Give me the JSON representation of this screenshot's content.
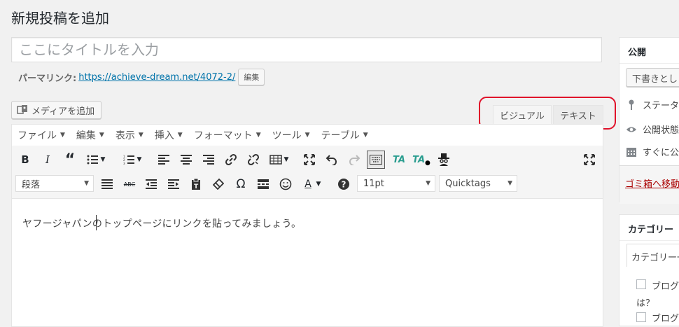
{
  "page_title": "新規投稿を追加",
  "title_placeholder": "ここにタイトルを入力",
  "permalink": {
    "label": "パーマリンク:",
    "url": "https://achieve-dream.net/4072-2/",
    "edit_label": "編集"
  },
  "media_button": "メディアを追加",
  "editor_tabs": {
    "visual": "ビジュアル",
    "text": "テキスト"
  },
  "menubar": [
    "ファイル",
    "編集",
    "表示",
    "挿入",
    "フォーマット",
    "ツール",
    "テーブル"
  ],
  "toolbar": {
    "format_select": "段落",
    "font_size_select": "11pt",
    "quicktags_select": "Quicktags"
  },
  "content": "ヤフージャパンのトップページにリンクを貼ってみましょう。",
  "sidebar": {
    "publish_title": "公開",
    "save_draft_button": "下書きとし",
    "status_label": "ステータ",
    "visibility_label": "公開状態",
    "schedule_label": "すぐに公",
    "trash_link": "ゴミ箱へ移動",
    "category_title": "カテゴリー",
    "category_tab": "カテゴリー一",
    "category_items": [
      "ブログ",
      "ブログ"
    ],
    "category_wrap_text": "は？"
  },
  "accent_colors": {
    "link": "#0073aa",
    "highlight_oval": "#e0112a",
    "trash": "#a00000"
  }
}
